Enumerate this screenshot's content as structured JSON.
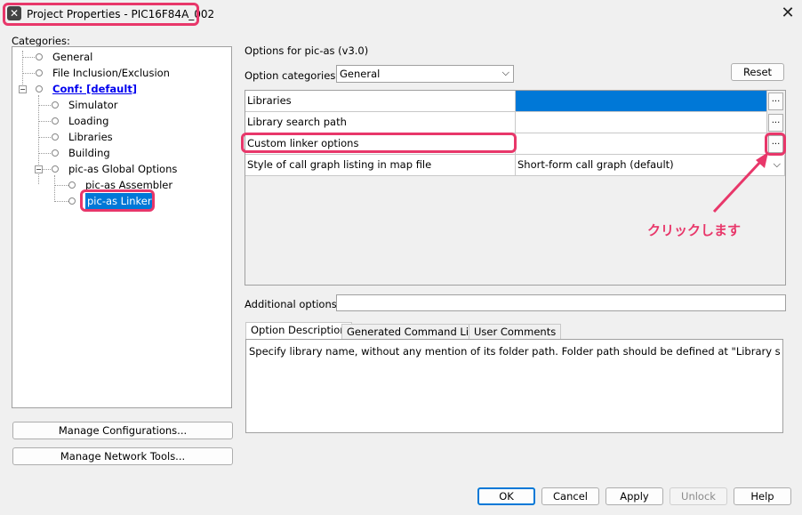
{
  "window": {
    "title": "Project Properties - PIC16F84A_002"
  },
  "categories": {
    "label": "Categories:",
    "items": [
      {
        "label": "General"
      },
      {
        "label": "File Inclusion/Exclusion"
      },
      {
        "label": "Conf: [default]"
      },
      {
        "label": "Simulator"
      },
      {
        "label": "Loading"
      },
      {
        "label": "Libraries"
      },
      {
        "label": "Building"
      },
      {
        "label": "pic-as Global Options"
      },
      {
        "label": "pic-as Assembler"
      },
      {
        "label": "pic-as Linker"
      }
    ]
  },
  "left_buttons": {
    "manage_configurations": "Manage Configurations...",
    "manage_network_tools": "Manage Network Tools..."
  },
  "options": {
    "header": "Options for pic-as (v3.0)",
    "category_label": "Option categories:",
    "category_value": "General",
    "reset_label": "Reset",
    "rows": [
      {
        "name": "Libraries",
        "value": ""
      },
      {
        "name": "Library search path",
        "value": ""
      },
      {
        "name": "Custom linker options",
        "value": ""
      },
      {
        "name": "Style of call graph listing in map file",
        "value": "Short-form call graph (default)"
      }
    ],
    "ellipsis": "...",
    "additional_label": "Additional options:",
    "additional_value": ""
  },
  "annotation": {
    "text": "クリックします",
    "color": "#e8376a"
  },
  "tabs": [
    {
      "label": "Option Description"
    },
    {
      "label": "Generated Command Line"
    },
    {
      "label": "User Comments"
    }
  ],
  "description": "Specify library name, without any mention of its folder path. Folder path should be defined at \"Library search path\".",
  "footer": {
    "ok": "OK",
    "cancel": "Cancel",
    "apply": "Apply",
    "unlock": "Unlock",
    "help": "Help"
  },
  "colors": {
    "highlight": "#e8376a",
    "selection": "#0078d7",
    "link": "#0000ee"
  }
}
